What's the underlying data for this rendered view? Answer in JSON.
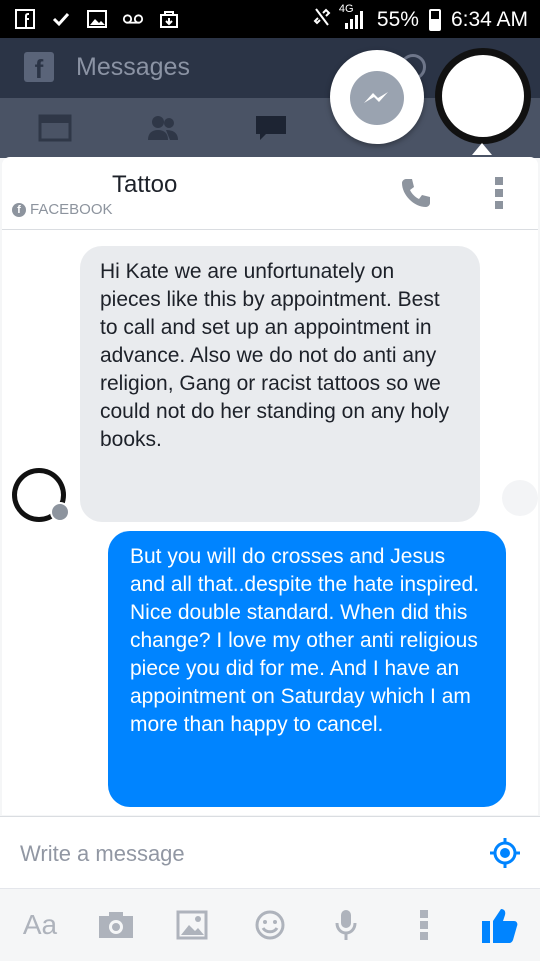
{
  "status_bar": {
    "network": "4G",
    "battery_percent": "55%",
    "time": "6:34 AM"
  },
  "app_header": {
    "title": "Messages"
  },
  "conversation": {
    "name": "Tattoo",
    "source": "FACEBOOK"
  },
  "messages": [
    {
      "direction": "incoming",
      "text": "Hi Kate we are unfortunately on pieces like this by appointment. Best to call and set up an appointment in advance. Also we do not do anti any religion,   Gang or racist tattoos so we could not do her standing on any holy books."
    },
    {
      "direction": "outgoing",
      "text": "But you will do crosses and Jesus and all that..despite the hate inspired. Nice double standard.  When did this change? I love my other anti religious piece you did for me. And I have an appointment on Saturday which I am more than happy to cancel."
    }
  ],
  "composer": {
    "placeholder": "Write a message"
  },
  "toolbar": {
    "text_label": "Aa"
  },
  "colors": {
    "accent": "#0084ff",
    "incoming_bubble": "#e9ebee",
    "header_bg": "#2b3446"
  }
}
